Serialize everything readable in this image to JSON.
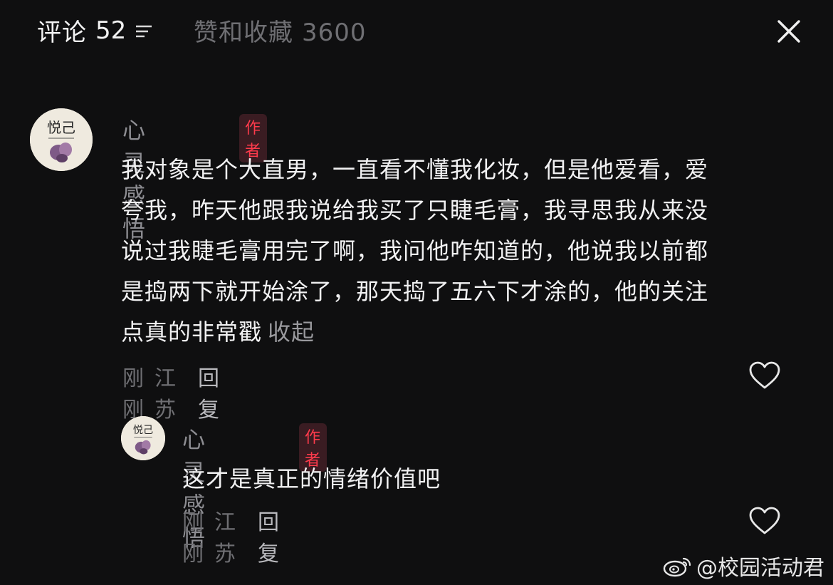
{
  "header": {
    "comments_label": "评论",
    "comments_count": "52",
    "likes_label": "赞和收藏",
    "likes_count": "3600"
  },
  "comments": [
    {
      "username": "心灵感悟",
      "badge": "作者",
      "avatar_text": "悦己",
      "text": "我对象是个大直男，一直看不懂我化妆，但是他爱看，爱夸我，昨天他跟我说给我买了只睫毛膏，我寻思我从来没说过我睫毛膏用完了啊，我问他咋知道的，他说我以前都是捣两下就开始涂了，那天捣了五六下才涂的，他的关注点真的非常戳",
      "lines": [
        "我对象是个大直男，一直看不懂我化妆，但是他爱看，爱",
        "夸我，昨天他跟我说给我买了只睫毛膏，我寻思我从来没",
        "说过我睫毛膏用完了啊，我问他咋知道的，他说我以前都",
        "是捣两下就开始涂了，那天捣了五六下才涂的，他的关注",
        "点真的非常戳"
      ],
      "collapse_label": "收起",
      "time": "刚刚",
      "location": "江苏",
      "reply_label": "回复"
    },
    {
      "username": "心灵感悟",
      "badge": "作者",
      "avatar_text": "悦己",
      "text": "这才是真正的情绪价值吧",
      "time": "刚刚",
      "location": "江苏",
      "reply_label": "回复"
    }
  ],
  "watermark": {
    "text": "@校园活动君"
  },
  "icons": {
    "sort": "sort-icon",
    "close": "close-icon",
    "heart": "heart-outline-icon",
    "weibo": "weibo-logo-icon"
  },
  "colors": {
    "background": "#0f0f10",
    "author_badge_text": "#ff3b4c",
    "author_badge_bg": "#3a1c22",
    "muted_text": "#6f6f73"
  }
}
